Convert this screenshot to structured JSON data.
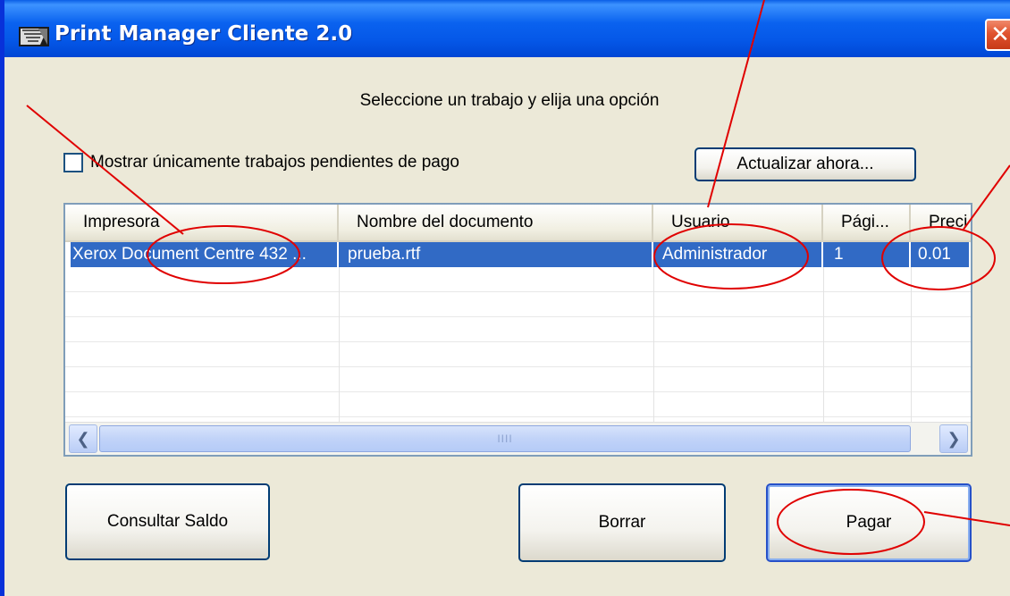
{
  "window": {
    "title": "Print Manager Cliente 2.0",
    "close_glyph": "✕",
    "accent": "#0a5ee6"
  },
  "instruction": "Seleccione un trabajo y elija una opción",
  "filter": {
    "checkbox_label": "Mostrar únicamente trabajos pendientes de pago",
    "checked": false
  },
  "buttons": {
    "refresh": "Actualizar ahora...",
    "balance": "Consultar Saldo",
    "delete": "Borrar",
    "pay": "Pagar"
  },
  "jobs": {
    "columns": [
      "Impresora",
      "Nombre del documento",
      "Usuario",
      "Pági...",
      "Preci"
    ],
    "rows": [
      [
        "Xerox Document Centre 432 ...",
        "prueba.rtf",
        "Administrador",
        "1",
        "0.01"
      ]
    ],
    "scrollbar_grip": "IIII"
  },
  "annotation_color": "#e00000",
  "icons": [
    "printer-app-icon",
    "close-icon",
    "scroll-left-arrow-icon",
    "scroll-right-arrow-icon"
  ]
}
